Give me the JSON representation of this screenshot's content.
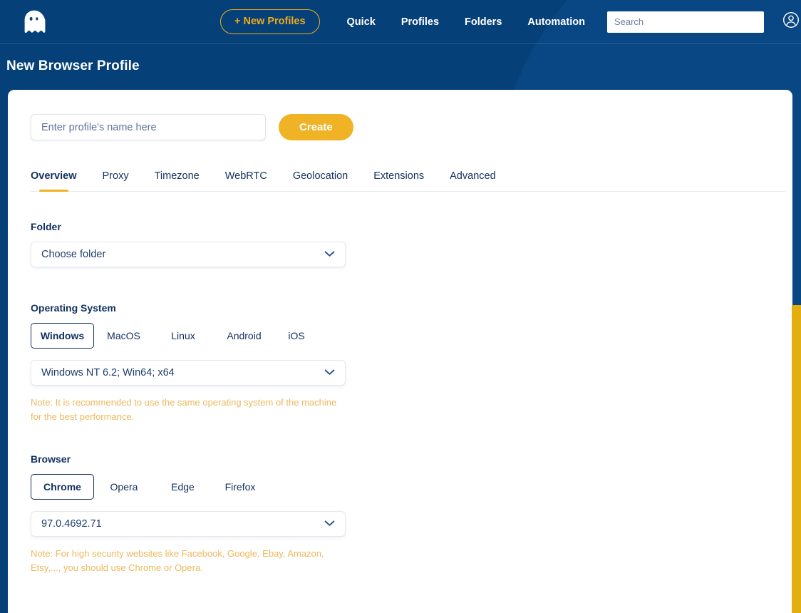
{
  "theme": {
    "navy": "#064079",
    "navy_light": "#0a4a87",
    "gold": "#efb325",
    "gold_scrollbar": "#e3ae10",
    "note_text": "#edb85e",
    "text_dark": "#11305e"
  },
  "navbar": {
    "logo_icon": "ghost-icon",
    "new_profiles_label": "+ New Profiles",
    "links": [
      {
        "label": "Quick"
      },
      {
        "label": "Profiles"
      },
      {
        "label": "Folders"
      },
      {
        "label": "Automation"
      }
    ],
    "search": {
      "placeholder": "Search",
      "value": ""
    },
    "account": {
      "icon": "user-circle-icon",
      "caret_icon": "chevron-down-icon"
    }
  },
  "page": {
    "title": "New Browser Profile"
  },
  "form": {
    "profile_name": {
      "placeholder": "Enter profile's name here",
      "value": ""
    },
    "create_label": "Create"
  },
  "tabs": [
    {
      "label": "Overview",
      "active": true
    },
    {
      "label": "Proxy",
      "active": false
    },
    {
      "label": "Timezone",
      "active": false
    },
    {
      "label": "WebRTC",
      "active": false
    },
    {
      "label": "Geolocation",
      "active": false
    },
    {
      "label": "Extensions",
      "active": false
    },
    {
      "label": "Advanced",
      "active": false
    }
  ],
  "folder": {
    "label": "Folder",
    "selected": "Choose folder"
  },
  "operating_system": {
    "label": "Operating System",
    "options": [
      "Windows",
      "MacOS",
      "Linux",
      "Android",
      "iOS"
    ],
    "selected": "Windows",
    "version_selected": "Windows NT 6.2; Win64; x64",
    "note": "Note: It is recommended to use the same operating system of the machine for the best performance."
  },
  "browser": {
    "label": "Browser",
    "options": [
      "Chrome",
      "Opera",
      "Edge",
      "Firefox"
    ],
    "selected": "Chrome",
    "version_selected": "97.0.4692.71",
    "note": "Note: For high security websites like Facebook, Google, Ebay, Amazon, Etsy,..., you should use Chrome or Opera."
  },
  "scrollbar": {
    "orientation": "vertical",
    "thumb_position_pct": 46
  }
}
